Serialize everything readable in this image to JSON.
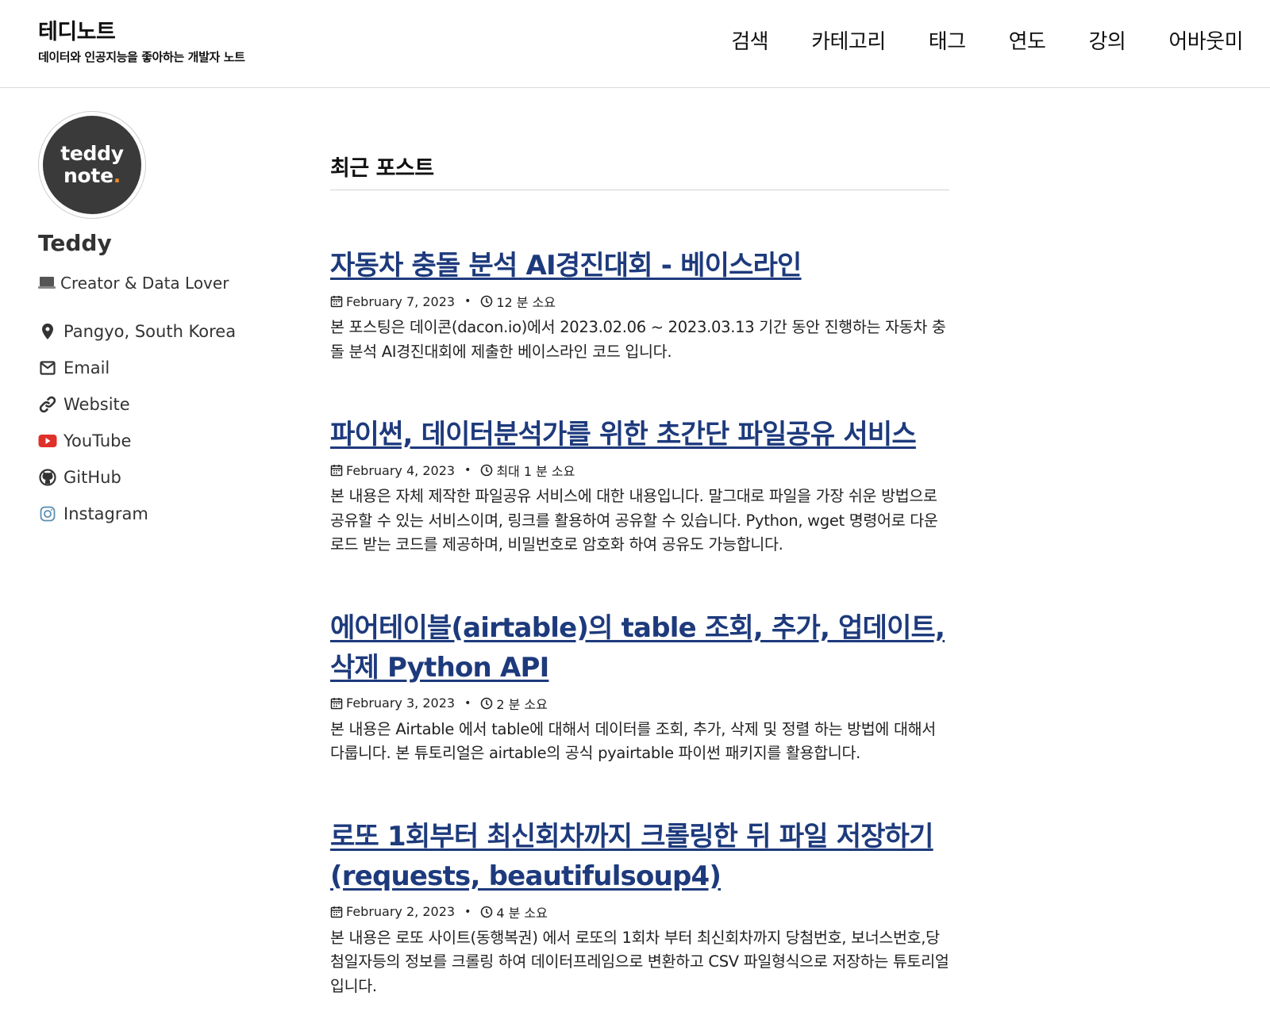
{
  "header": {
    "title": "테디노트",
    "subtitle": "데이터와 인공지능을 좋아하는 개발자 노트",
    "nav": [
      "검색",
      "카테고리",
      "태그",
      "연도",
      "강의",
      "어바웃미"
    ]
  },
  "sidebar": {
    "avatar_line1": "teddy",
    "avatar_line2": "note",
    "avatar_dot": ".",
    "name": "Teddy",
    "bio": "Creator & Data Lover",
    "links": [
      {
        "icon": "map-pin-icon",
        "label": "Pangyo, South Korea"
      },
      {
        "icon": "envelope-icon",
        "label": "Email"
      },
      {
        "icon": "link-icon",
        "label": "Website"
      },
      {
        "icon": "youtube-icon",
        "label": "YouTube"
      },
      {
        "icon": "github-icon",
        "label": "GitHub"
      },
      {
        "icon": "instagram-icon",
        "label": "Instagram"
      }
    ]
  },
  "main": {
    "section_title": "최근 포스트",
    "posts": [
      {
        "title": "자동차 충돌 분석 AI경진대회 - 베이스라인",
        "date": "February 7, 2023",
        "read_time": "12 분 소요",
        "excerpt": "본 포스팅은 데이콘(dacon.io)에서 2023.02.06 ~ 2023.03.13 기간 동안 진행하는 자동차 충돌 분석 AI경진대회에 제출한 베이스라인 코드 입니다."
      },
      {
        "title": "파이썬, 데이터분석가를 위한 초간단 파일공유 서비스",
        "date": "February 4, 2023",
        "read_time": "최대 1 분 소요",
        "excerpt": "본 내용은 자체 제작한 파일공유 서비스에 대한 내용입니다. 말그대로 파일을 가장 쉬운 방법으로 공유할 수 있는 서비스이며, 링크를 활용하여 공유할 수 있습니다. Python, wget 명령어로 다운로드 받는 코드를 제공하며, 비밀번호로 암호화 하여 공유도 가능합니다."
      },
      {
        "title": "에어테이블(airtable)의 table 조회, 추가, 업데이트, 삭제 Python API",
        "date": "February 3, 2023",
        "read_time": "2 분 소요",
        "excerpt": "본 내용은 Airtable 에서 table에 대해서 데이터를 조회, 추가, 삭제 및 정렬 하는 방법에 대해서 다룹니다. 본 튜토리얼은 airtable의 공식 pyairtable 파이썬 패키지를 활용합니다."
      },
      {
        "title": "로또 1회부터 최신회차까지 크롤링한 뒤 파일 저장하기 (requests, beautifulsoup4)",
        "date": "February 2, 2023",
        "read_time": "4 분 소요",
        "excerpt": "본 내용은 로또 사이트(동행복권) 에서 로또의 1회차 부터 최신회차까지 당첨번호, 보너스번호,당첨일자등의 정보를 크롤링 하여 데이터프레임으로 변환하고 CSV 파일형식으로 저장하는 튜토리얼입니다."
      }
    ]
  },
  "colors": {
    "link": "#1d3a7c",
    "youtube": "#e0302a",
    "instagram": "#5b8fb0",
    "accent_dot": "#f08a24"
  }
}
